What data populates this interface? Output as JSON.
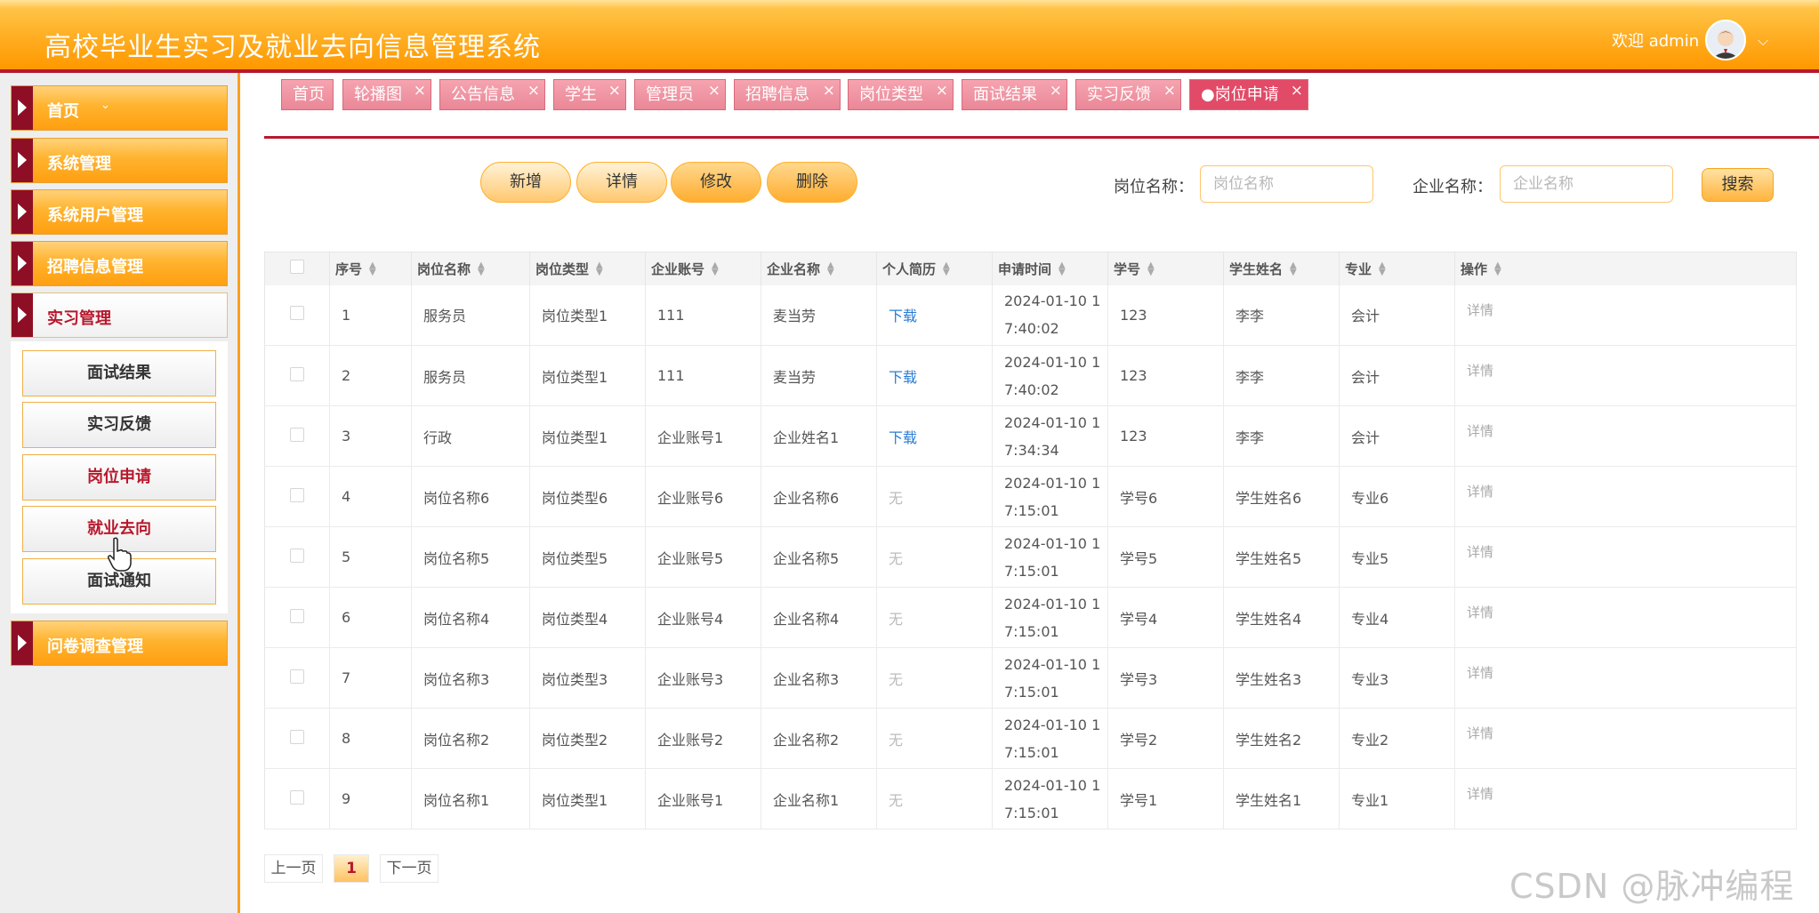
{
  "header": {
    "title": "高校毕业生实习及就业去向信息管理系统",
    "welcome": "欢迎 admin"
  },
  "sidebar": {
    "menus": [
      {
        "label": "首页",
        "dropdown": "⌄"
      },
      {
        "label": "系统管理"
      },
      {
        "label": "系统用户管理"
      },
      {
        "label": "招聘信息管理"
      },
      {
        "label": "实习管理"
      },
      {
        "label": "问卷调查管理"
      }
    ],
    "submenus": [
      "面试结果",
      "实习反馈",
      "岗位申请",
      "就业去向",
      "面试通知"
    ]
  },
  "tabs": [
    "首页",
    "轮播图",
    "公告信息",
    "学生",
    "管理员",
    "招聘信息",
    "岗位类型",
    "面试结果",
    "实习反馈",
    "●岗位申请"
  ],
  "toolbar": {
    "add": "新增",
    "detail": "详情",
    "edit": "修改",
    "delete": "删除"
  },
  "search": {
    "job_label": "岗位名称：",
    "job_placeholder": "岗位名称",
    "company_label": "企业名称：",
    "company_placeholder": "企业名称",
    "button": "搜索"
  },
  "table": {
    "headers": [
      "序号",
      "岗位名称",
      "岗位类型",
      "企业账号",
      "企业名称",
      "个人简历",
      "申请时间",
      "学号",
      "学生姓名",
      "专业",
      "操作"
    ],
    "rows": [
      {
        "no": "1",
        "job": "服务员",
        "type": "岗位类型1",
        "account": "111",
        "company": "麦当劳",
        "resume": "下载",
        "time1": "2024-01-10 1",
        "time2": "7:40:02",
        "sid": "123",
        "name": "李李",
        "major": "会计",
        "op": "详情"
      },
      {
        "no": "2",
        "job": "服务员",
        "type": "岗位类型1",
        "account": "111",
        "company": "麦当劳",
        "resume": "下载",
        "time1": "2024-01-10 1",
        "time2": "7:40:02",
        "sid": "123",
        "name": "李李",
        "major": "会计",
        "op": "详情"
      },
      {
        "no": "3",
        "job": "行政",
        "type": "岗位类型1",
        "account": "企业账号1",
        "company": "企业姓名1",
        "resume": "下载",
        "time1": "2024-01-10 1",
        "time2": "7:34:34",
        "sid": "123",
        "name": "李李",
        "major": "会计",
        "op": "详情"
      },
      {
        "no": "4",
        "job": "岗位名称6",
        "type": "岗位类型6",
        "account": "企业账号6",
        "company": "企业名称6",
        "resume": "无",
        "time1": "2024-01-10 1",
        "time2": "7:15:01",
        "sid": "学号6",
        "name": "学生姓名6",
        "major": "专业6",
        "op": "详情"
      },
      {
        "no": "5",
        "job": "岗位名称5",
        "type": "岗位类型5",
        "account": "企业账号5",
        "company": "企业名称5",
        "resume": "无",
        "time1": "2024-01-10 1",
        "time2": "7:15:01",
        "sid": "学号5",
        "name": "学生姓名5",
        "major": "专业5",
        "op": "详情"
      },
      {
        "no": "6",
        "job": "岗位名称4",
        "type": "岗位类型4",
        "account": "企业账号4",
        "company": "企业名称4",
        "resume": "无",
        "time1": "2024-01-10 1",
        "time2": "7:15:01",
        "sid": "学号4",
        "name": "学生姓名4",
        "major": "专业4",
        "op": "详情"
      },
      {
        "no": "7",
        "job": "岗位名称3",
        "type": "岗位类型3",
        "account": "企业账号3",
        "company": "企业名称3",
        "resume": "无",
        "time1": "2024-01-10 1",
        "time2": "7:15:01",
        "sid": "学号3",
        "name": "学生姓名3",
        "major": "专业3",
        "op": "详情"
      },
      {
        "no": "8",
        "job": "岗位名称2",
        "type": "岗位类型2",
        "account": "企业账号2",
        "company": "企业名称2",
        "resume": "无",
        "time1": "2024-01-10 1",
        "time2": "7:15:01",
        "sid": "学号2",
        "name": "学生姓名2",
        "major": "专业2",
        "op": "详情"
      },
      {
        "no": "9",
        "job": "岗位名称1",
        "type": "岗位类型1",
        "account": "企业账号1",
        "company": "企业名称1",
        "resume": "无",
        "time1": "2024-01-10 1",
        "time2": "7:15:01",
        "sid": "学号1",
        "name": "学生姓名1",
        "major": "专业1",
        "op": "详情"
      }
    ]
  },
  "pagination": {
    "prev": "上一页",
    "current": "1",
    "next": "下一页"
  },
  "watermark": "CSDN @脉冲编程者",
  "colors": {
    "header_orange": "#ff9800",
    "accent_red": "#b8182c",
    "tab_pink": "#ea8797",
    "link_blue": "#2b7cd3"
  }
}
